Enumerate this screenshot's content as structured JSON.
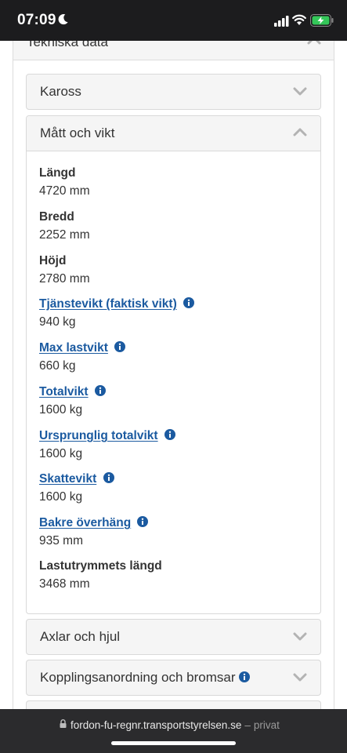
{
  "status_bar": {
    "time": "07:09"
  },
  "outer_section": {
    "title": "Tekniska data"
  },
  "accordions": {
    "kaross": "Kaross",
    "matt": "Mått och vikt",
    "axlar": "Axlar och hjul",
    "koppling": "Kopplingsanordning och bromsar"
  },
  "fields": [
    {
      "label": "Längd",
      "value": "4720 mm"
    },
    {
      "label": "Bredd",
      "value": "2252 mm"
    },
    {
      "label": "Höjd",
      "value": "2780 mm"
    },
    {
      "label": "Tjänstevikt (faktisk vikt)",
      "value": "940 kg"
    },
    {
      "label": "Max lastvikt",
      "value": "660 kg"
    },
    {
      "label": "Totalvikt",
      "value": "1600 kg"
    },
    {
      "label": "Ursprunglig totalvikt",
      "value": "1600 kg"
    },
    {
      "label": "Skattevikt",
      "value": "1600 kg"
    },
    {
      "label": "Bakre överhäng",
      "value": "935 mm"
    },
    {
      "label": "Lastutrymmets längd",
      "value": "3468 mm"
    }
  ],
  "browser": {
    "domain": "fordon-fu-regnr.transportstyrelsen.se",
    "separator": "–",
    "mode": "privat"
  },
  "icons": {
    "info": "info-circle-icon",
    "chevron": "chevron-icon",
    "lock": "lock-icon"
  },
  "colors": {
    "link": "#1b5aa0",
    "panel_header": "#f5f5f5"
  }
}
